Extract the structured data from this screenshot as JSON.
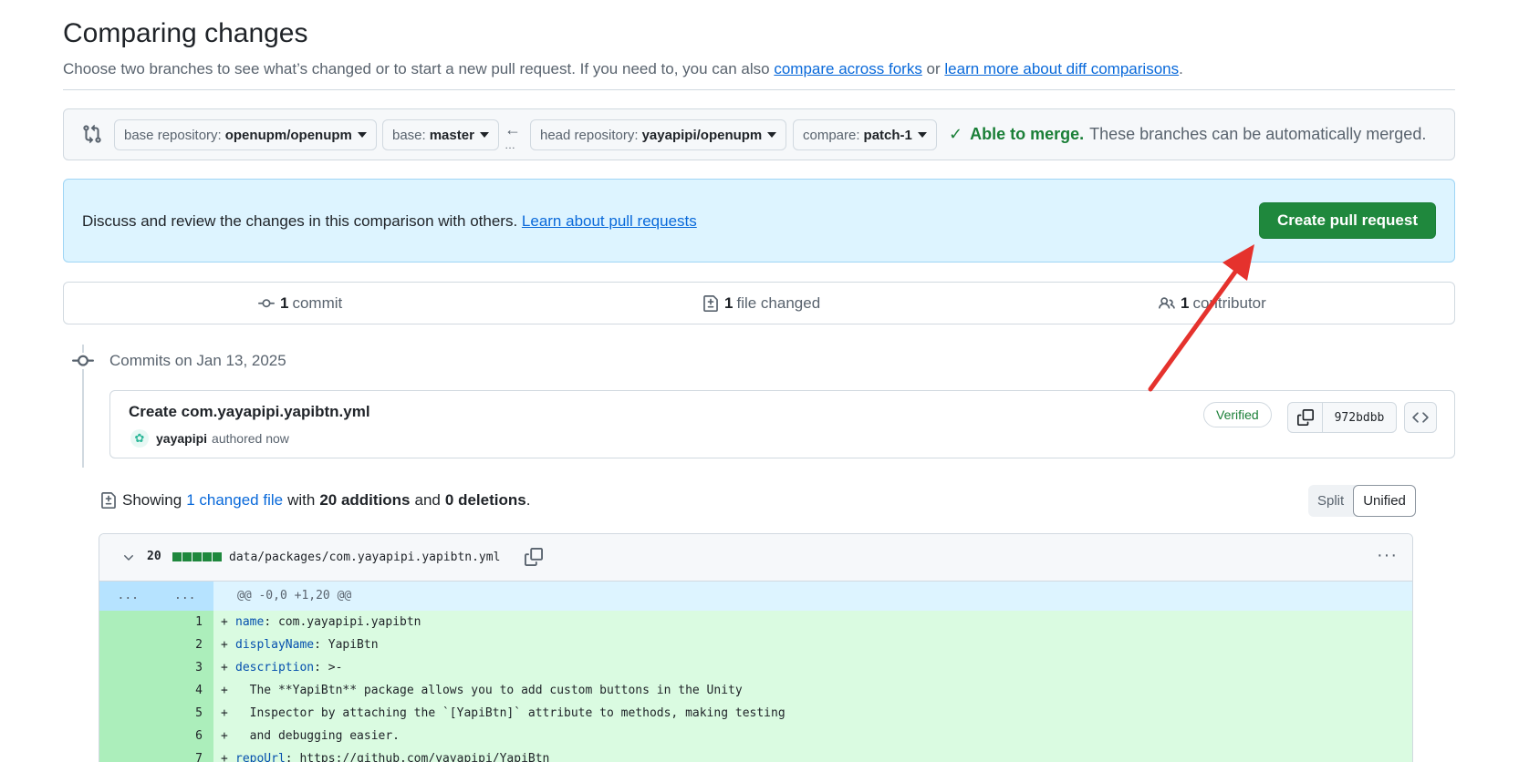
{
  "header": {
    "title": "Comparing changes",
    "subtitle_prefix": "Choose two branches to see what’s changed or to start a new pull request. If you need to, you can also ",
    "link_forks": "compare across forks",
    "subtitle_mid": " or ",
    "link_diff": "learn more about diff comparisons",
    "subtitle_end": "."
  },
  "range": {
    "base_repo_label": "base repository:",
    "base_repo_value": "openupm/openupm",
    "base_label": "base:",
    "base_value": "master",
    "head_repo_label": "head repository:",
    "head_repo_value": "yayapipi/openupm",
    "compare_label": "compare:",
    "compare_value": "patch-1",
    "merge_status_bold": "Able to merge.",
    "merge_status_text": "These branches can be automatically merged."
  },
  "banner": {
    "text": "Discuss and review the changes in this comparison with others. ",
    "link": "Learn about pull requests",
    "button": "Create pull request"
  },
  "stats": {
    "commits_count": "1",
    "commits_label": "commit",
    "files_count": "1",
    "files_label": "file changed",
    "contrib_count": "1",
    "contrib_label": "contributor"
  },
  "commits": {
    "date_heading": "Commits on Jan 13, 2025",
    "items": [
      {
        "title": "Create com.yayapipi.yapibtn.yml",
        "author": "yayapipi",
        "time": "authored now",
        "verified": "Verified",
        "sha": "972bdbb"
      }
    ]
  },
  "summary": {
    "prefix": "Showing",
    "files_link": "1 changed file",
    "with": "with",
    "additions": "20 additions",
    "and": "and",
    "deletions": "0 deletions",
    "end": "."
  },
  "view_toggle": {
    "split": "Split",
    "unified": "Unified",
    "selected": "Unified"
  },
  "diff_file": {
    "change_count": "20",
    "path": "data/packages/com.yayapipi.yapibtn.yml",
    "hunk_left": "...",
    "hunk_right": "...",
    "hunk_header": "@@ -0,0 +1,20 @@",
    "lines": [
      {
        "num": "1",
        "key": "name",
        "rest": ": com.yayapipi.yapibtn"
      },
      {
        "num": "2",
        "key": "displayName",
        "rest": ": YapiBtn"
      },
      {
        "num": "3",
        "key": "description",
        "rest": ": >-"
      },
      {
        "num": "4",
        "key": "",
        "rest": "  The **YapiBtn** package allows you to add custom buttons in the Unity"
      },
      {
        "num": "5",
        "key": "",
        "rest": "  Inspector by attaching the `[YapiBtn]` attribute to methods, making testing"
      },
      {
        "num": "6",
        "key": "",
        "rest": "  and debugging easier."
      },
      {
        "num": "7",
        "key": "repoUrl",
        "rest": ": https://github.com/yayapipi/YapiBtn"
      }
    ]
  },
  "colors": {
    "primary_button": "#1f883d",
    "success": "#1a7f37",
    "link": "#0969da",
    "banner_bg": "#ddf4ff",
    "addition_bg": "#dafbe1",
    "annotation_arrow": "#e5322d"
  }
}
